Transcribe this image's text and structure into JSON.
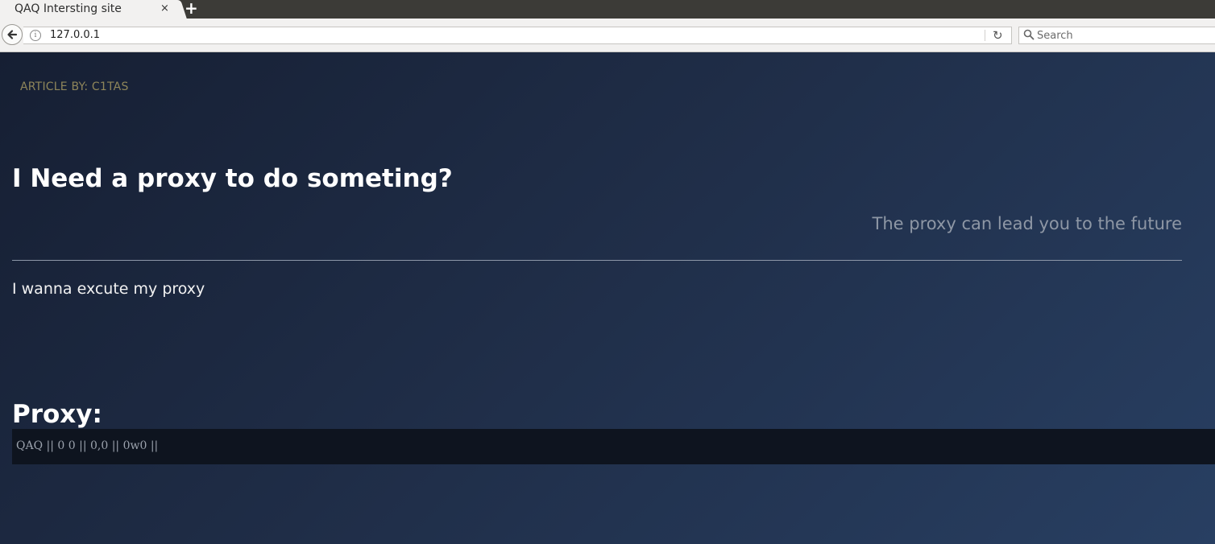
{
  "browser": {
    "tab_title": "QAQ Intersting site",
    "tab_close": "×",
    "new_tab": "+",
    "url": "127.0.0.1",
    "info_glyph": "i",
    "reload_glyph": "↻",
    "search_placeholder": "Search"
  },
  "page": {
    "author": "ARTICLE BY: C1TAS",
    "title": "I Need a proxy to do someting?",
    "subtitle": "The proxy can lead you to the future",
    "intro": "I wanna excute my proxy",
    "proxy_heading": "Proxy:",
    "proxy_output": "QAQ || 0 0 || 0,0 || 0w0 ||"
  },
  "colors": {
    "background_start": "#161f33",
    "background_end": "#283f62",
    "author": "#8f865a",
    "subtitle": "#8e97a5",
    "output_box": "#0e141f"
  }
}
